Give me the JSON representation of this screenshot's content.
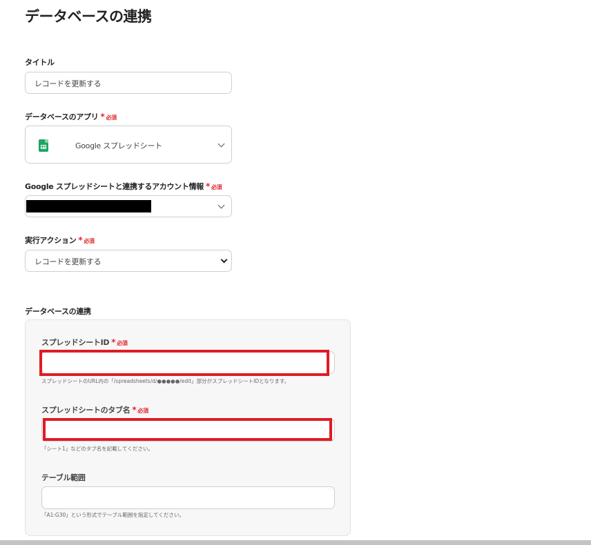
{
  "page": {
    "title": "データベースの連携"
  },
  "required": {
    "star": "*",
    "text": "必須"
  },
  "fields": {
    "title": {
      "label": "タイトル",
      "value": "レコードを更新する"
    },
    "app": {
      "label": "データベースのアプリ",
      "value": "Google スプレッドシート",
      "icon": "google-sheets-icon"
    },
    "account": {
      "label": "Google スプレッドシートと連携するアカウント情報",
      "value": ""
    },
    "action": {
      "label": "実行アクション",
      "value": "レコードを更新する"
    }
  },
  "db_section": {
    "heading": "データベースの連携",
    "spreadsheet_id": {
      "label": "スプレッドシートID",
      "value": "",
      "help": "スプレッドシートのURL内の「/spreadsheets/d/●●●●●/edit」部分がスプレッドシートIDとなります。"
    },
    "tab_name": {
      "label": "スプレッドシートのタブ名",
      "value": "",
      "help": "「シート1」などのタブ名を記載してください。"
    },
    "table_range": {
      "label": "テーブル範囲",
      "value": "",
      "help": "「A1:G30」という形式でテーブル範囲を指定してください。"
    }
  },
  "colors": {
    "required": "#e0242b",
    "highlight": "#e01b24",
    "sheets_green": "#1fa463"
  }
}
